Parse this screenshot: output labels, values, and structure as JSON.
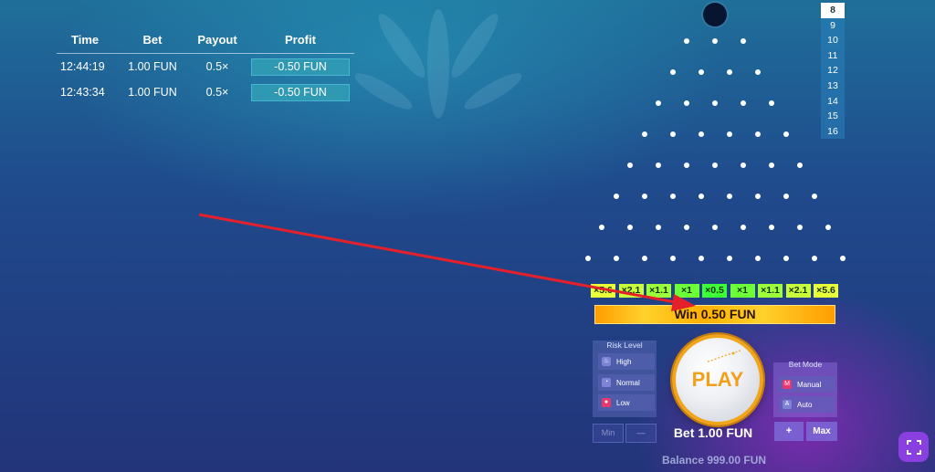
{
  "history": {
    "headers": {
      "time": "Time",
      "bet": "Bet",
      "payout": "Payout",
      "profit": "Profit"
    },
    "rows": [
      {
        "time": "12:44:19",
        "bet": "1.00 FUN",
        "payout": "0.5×",
        "profit": "-0.50 FUN"
      },
      {
        "time": "12:43:34",
        "bet": "1.00 FUN",
        "payout": "0.5×",
        "profit": "-0.50 FUN"
      }
    ]
  },
  "rows_selector": {
    "options": [
      "8",
      "9",
      "10",
      "11",
      "12",
      "13",
      "14",
      "15",
      "16"
    ],
    "selected": "8"
  },
  "multipliers": [
    {
      "label": "×5.6",
      "color": "#e8ff3a"
    },
    {
      "label": "×2.1",
      "color": "#c9ff3a"
    },
    {
      "label": "×1.1",
      "color": "#9cff39"
    },
    {
      "label": "×1",
      "color": "#6cff37"
    },
    {
      "label": "×0.5",
      "color": "#3cff36"
    },
    {
      "label": "×1",
      "color": "#6cff37"
    },
    {
      "label": "×1.1",
      "color": "#9cff39"
    },
    {
      "label": "×2.1",
      "color": "#c9ff3a"
    },
    {
      "label": "×5.6",
      "color": "#e8ff3a"
    }
  ],
  "win_text": "Win 0.50 FUN",
  "risk_level": {
    "title": "Risk Level",
    "options": [
      "High",
      "Normal",
      "Low"
    ]
  },
  "bet_mode": {
    "title": "Bet Mode",
    "options": [
      "Manual",
      "Auto"
    ],
    "icons": [
      "M",
      "A"
    ]
  },
  "play_label": "PLAY",
  "controls": {
    "min": "Min",
    "minus": "—",
    "plus": "+",
    "max": "Max"
  },
  "bet_text": "Bet 1.00 FUN",
  "balance_text": "Balance 999.00 FUN",
  "colors": {
    "accent": "#f0a51b",
    "win_banner": "#ffb000",
    "profit_pill": "#2f98b2",
    "arrow": "#e5202a"
  }
}
